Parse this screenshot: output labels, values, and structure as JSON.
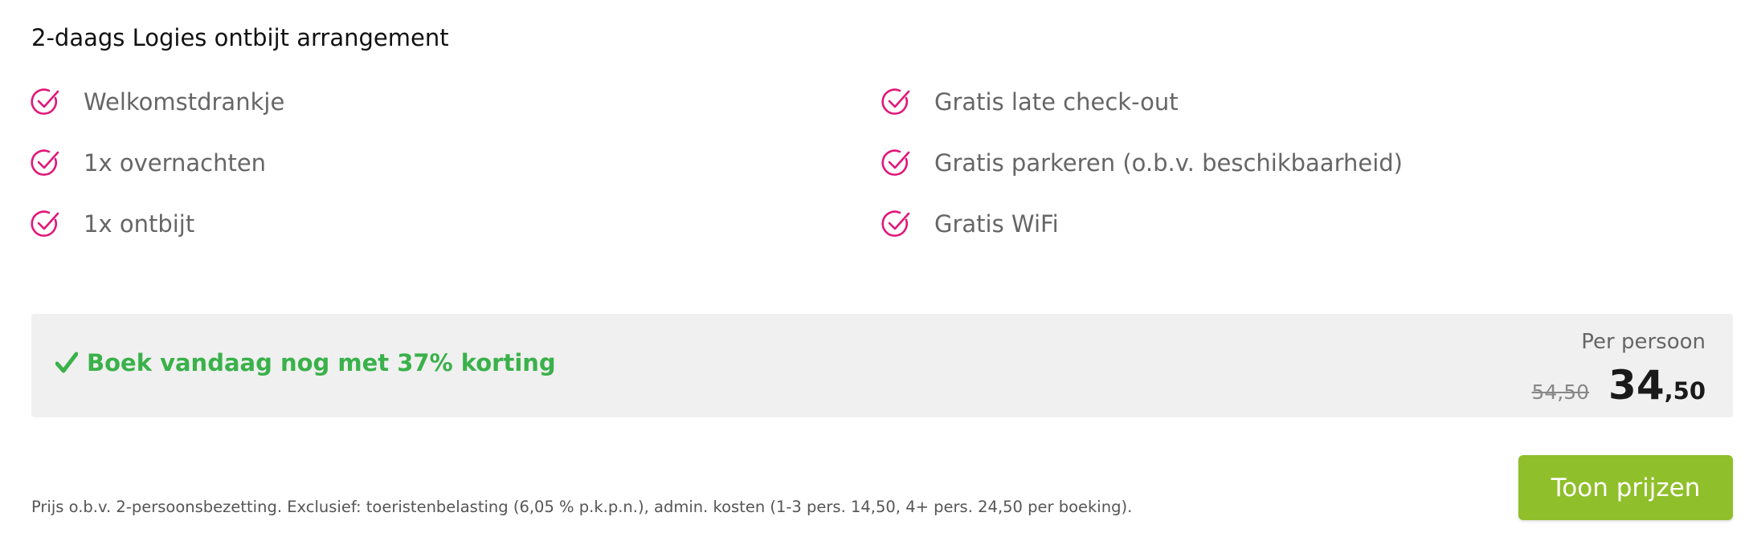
{
  "package": {
    "title": "2-daags Logies ontbijt arrangement"
  },
  "features": {
    "left": [
      {
        "label": "Welkomstdrankje",
        "icon": "check-circle-icon"
      },
      {
        "label": "1x overnachten",
        "icon": "check-circle-icon"
      },
      {
        "label": "1x ontbijt",
        "icon": "check-circle-icon"
      }
    ],
    "right": [
      {
        "label": "Gratis late check-out",
        "icon": "check-circle-icon"
      },
      {
        "label": "Gratis parkeren (o.b.v. beschikbaarheid)",
        "icon": "check-circle-icon"
      },
      {
        "label": "Gratis WiFi",
        "icon": "check-circle-icon"
      }
    ]
  },
  "pricing": {
    "promo_text": "Boek vandaag nog met 37% korting",
    "per_person_label": "Per persoon",
    "old_price": "54,50",
    "new_price_int": "34",
    "new_price_dec": ",50"
  },
  "disclaimer": "Prijs o.b.v. 2-persoonsbezetting. Exclusief: toeristenbelasting (6,05 % p.k.p.n.), admin. kosten (1-3 pers. 14,50, 4+ pers. 24,50 per boeking).",
  "cta": {
    "label": "Toon prijzen"
  },
  "colors": {
    "accent_pink": "#e0177a",
    "promo_green": "#3ab14a",
    "cta_green": "#8fbf2a",
    "panel_grey": "#f0f0f0"
  }
}
